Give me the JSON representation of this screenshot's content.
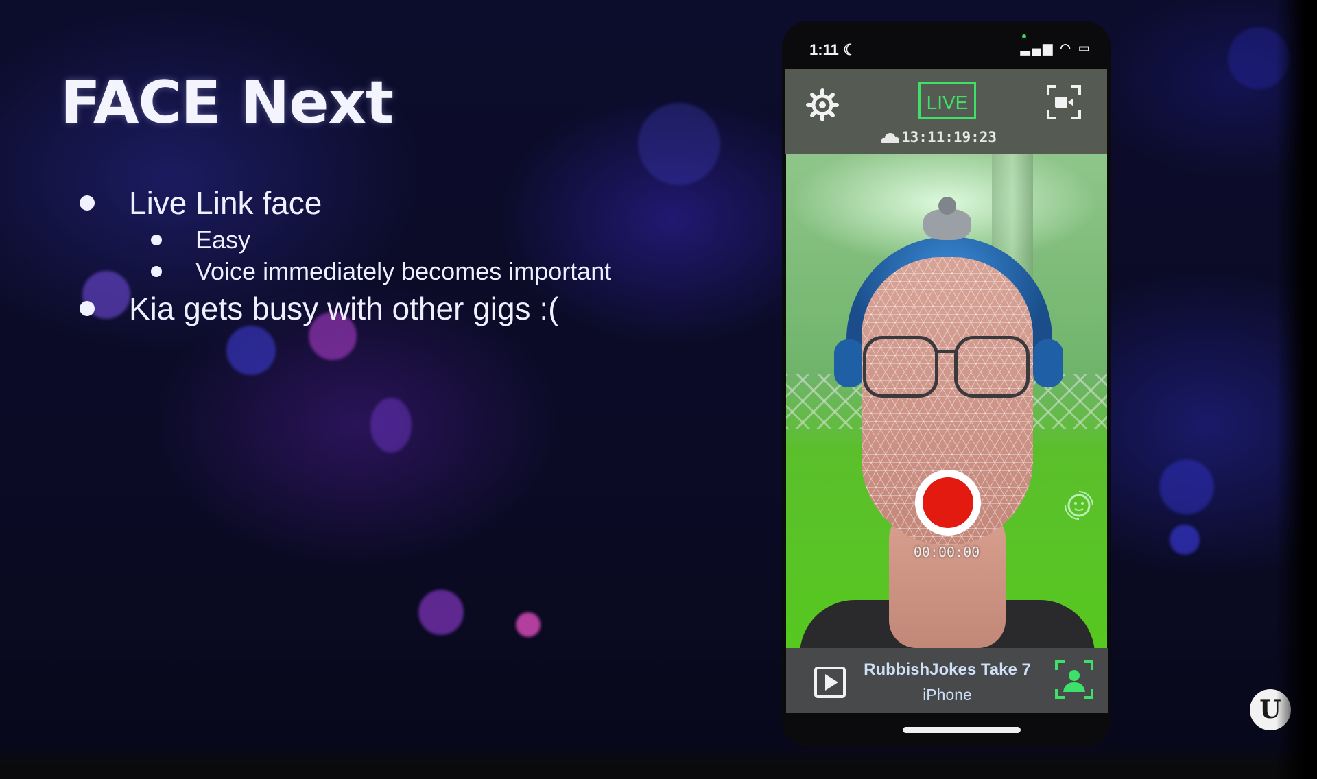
{
  "slide": {
    "title": "FACE Next",
    "bullets": [
      {
        "text": "Live Link face",
        "sub": [
          "Easy",
          "Voice immediately becomes important"
        ]
      },
      {
        "text": "Kia gets busy with other gigs  :("
      }
    ]
  },
  "phone": {
    "status_bar": {
      "time": "1:11",
      "icons": [
        "moon-icon",
        "signal-icon",
        "wifi-icon",
        "battery-icon"
      ]
    },
    "app": {
      "live_label": "LIVE",
      "timecode": "13:11:19:23",
      "record_timer": "00:00:00",
      "take_name": "RubbishJokes Take 7",
      "device_name": "iPhone",
      "icons": [
        "gear-icon",
        "camera-frame-icon",
        "cloud-icon",
        "record-icon",
        "face-tracking-icon",
        "play-icon",
        "face-camera-icon"
      ]
    }
  },
  "colors": {
    "live_green": "#3ee06a",
    "record_red": "#e21a10",
    "top_bar": "#555b52",
    "bottom_bar": "#48494b"
  },
  "logo": "unreal-engine-logo"
}
